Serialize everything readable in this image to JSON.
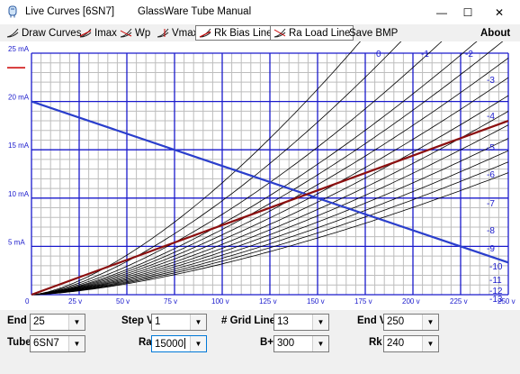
{
  "window": {
    "title": "Live Curves [6SN7]",
    "app_name": "GlassWare Tube Manual",
    "minimize": "—",
    "maximize": "☐",
    "close": "✕"
  },
  "menu": {
    "draw_curves": "Draw Curves",
    "imax": "Imax",
    "wp": "Wp",
    "vmax": "Vmax",
    "rk_bias_line": "Rk Bias Line",
    "ra_load_line": "Ra Load Line",
    "save_bmp": "Save BMP",
    "about": "About"
  },
  "chart_data": {
    "type": "line",
    "x_tick_labels": [
      "0",
      "25 v",
      "50 v",
      "75 v",
      "100 v",
      "125 v",
      "150 v",
      "175 v",
      "200 v",
      "225 v",
      "250 v"
    ],
    "y_tick_labels": [
      "5 mA",
      "10 mA",
      "15 mA",
      "20 mA",
      "25 mA"
    ],
    "xlim": [
      0,
      250
    ],
    "ylim": [
      0,
      25
    ],
    "grid": true,
    "grid_curves": [
      {
        "name": "0",
        "v_end": 178
      },
      {
        "name": "-1",
        "v_end": 200
      },
      {
        "name": "-2",
        "v_end": 222
      },
      {
        "name": "-3",
        "v_end": 241
      },
      {
        "name": "-4",
        "v_end": 255
      },
      {
        "name": "-5",
        "v_end": 270
      },
      {
        "name": "-6",
        "v_end": 286
      },
      {
        "name": "-7",
        "v_end": 303
      },
      {
        "name": "-8",
        "v_end": 320
      },
      {
        "name": "-9",
        "v_end": 337
      },
      {
        "name": "-10",
        "v_end": 356
      },
      {
        "name": "-11",
        "v_end": 376
      },
      {
        "name": "-12",
        "v_end": 397
      },
      {
        "name": "-13",
        "v_end": 420
      }
    ],
    "load_line": {
      "x": [
        0,
        250
      ],
      "y": [
        20,
        3.33
      ]
    },
    "bias_line": {
      "x": [
        0,
        250
      ],
      "y": [
        0,
        18
      ]
    },
    "colors": {
      "grid": "#1a1acc",
      "curves": "#000000",
      "load_line": "#2a3ecc",
      "bias_line": "#8b0f0f"
    }
  },
  "controls": {
    "end_i": {
      "label": "End I",
      "value": "25"
    },
    "step_v": {
      "label": "Step V",
      "value": "1"
    },
    "grid_lines": {
      "label": "# Grid Lines",
      "value": "13"
    },
    "end_v": {
      "label": "End V",
      "value": "250"
    },
    "tube": {
      "label": "Tube",
      "value": "6SN7"
    },
    "ra": {
      "label": "Ra",
      "value": "15000"
    },
    "b_plus": {
      "label": "B+",
      "value": "300"
    },
    "rk": {
      "label": "Rk",
      "value": "240"
    }
  }
}
